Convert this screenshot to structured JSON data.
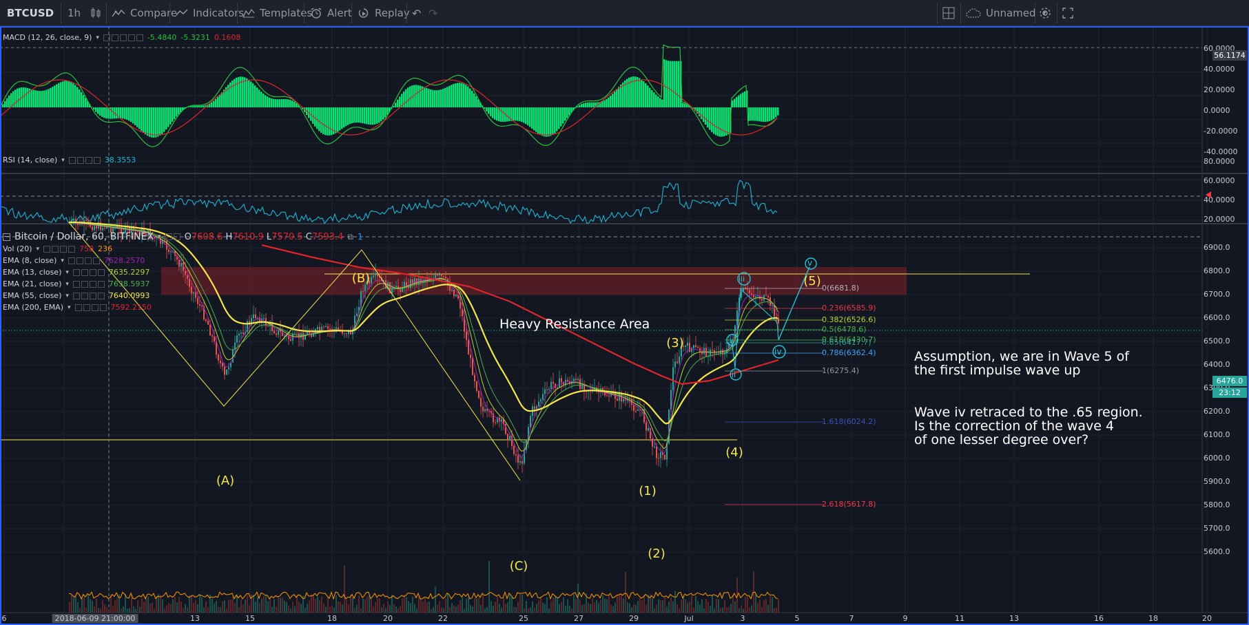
{
  "toolbar": {
    "symbol": "BTCUSD",
    "interval": "1h",
    "compare": "Compare",
    "indicators": "Indicators",
    "templates": "Templates",
    "alert": "Alert",
    "replay": "Replay",
    "layout_name": "Unnamed"
  },
  "macd": {
    "title": "MACD (12, 26, close, 9)",
    "v1": "-5.4840",
    "v2": "-5.3231",
    "v3": "0.1608",
    "ticks": [
      "60.0000",
      "40.0000",
      "20.0000",
      "0.0000",
      "-20.0000",
      "-40.0000"
    ],
    "last_tag": "56.1174"
  },
  "rsi": {
    "title": "RSI (14, close)",
    "value": "38.3553",
    "ticks": [
      "80.0000",
      "60.0000",
      "40.0000",
      "20.0000"
    ]
  },
  "main": {
    "title": "Bitcoin / Dollar, 60, BITFINEX",
    "o_label": "O",
    "o": "7608.6",
    "h_label": "H",
    "h": "7610.9",
    "l_label": "L",
    "l": "7570.5",
    "c_label": "C",
    "c": "7593.4",
    "alert_count": "1",
    "indicators": [
      {
        "name": "Vol (20)",
        "value": "758",
        "value2": "236"
      },
      {
        "name": "EMA (8, close)",
        "value": "7628.2570"
      },
      {
        "name": "EMA (13, close)",
        "value": "7635.2297"
      },
      {
        "name": "EMA (21, close)",
        "value": "7638.5937"
      },
      {
        "name": "EMA (55, close)",
        "value": "7640.0993"
      },
      {
        "name": "EMA (200, EMA)",
        "value": "7592.2150"
      }
    ],
    "price_ticks": [
      "6900.0",
      "6800.0",
      "6700.0",
      "6600.0",
      "6500.0",
      "6400.0",
      "6300.0",
      "6200.0",
      "6100.0",
      "6000.0",
      "5900.0",
      "5800.0",
      "5700.0",
      "5600.0"
    ],
    "last_price": "6476.0",
    "countdown": "23:12",
    "resistance_label": "Heavy Resistance Area",
    "waves": {
      "A": "(A)",
      "B": "(B)",
      "C": "(C)",
      "w1": "(1)",
      "w2": "(2)",
      "w3": "(3)",
      "w4": "(4)",
      "w5": "(5)",
      "i": "i",
      "ii": "ii",
      "iii": "iii",
      "iv": "iv",
      "v": "v"
    },
    "fib": [
      {
        "label": "0(6681.8)",
        "color": "#b2b5be"
      },
      {
        "label": "0.236(6585.9)",
        "color": "#f23645"
      },
      {
        "label": "0.382(6526.6)",
        "color": "#b5d334"
      },
      {
        "label": "0.5(6478.6)",
        "color": "#4caf50"
      },
      {
        "label": "0.618(6430.7)",
        "color": "#4caf50"
      },
      {
        "label": "0.65(6417.7)",
        "color": "#26a69a"
      },
      {
        "label": "0.786(6362.4)",
        "color": "#42a5f5"
      },
      {
        "label": "1(6275.4)",
        "color": "#9598a1"
      },
      {
        "label": "1.618(6024.2)",
        "color": "#3f51b5"
      },
      {
        "label": "2.618(5617.8)",
        "color": "#f23645"
      }
    ],
    "annotation1": [
      "Assumption, we are in Wave 5 of",
      "the first impulse wave up"
    ],
    "annotation2": [
      "Wave iv retraced to the .65 region.",
      "Is the correction of the wave 4",
      "of one lesser degree over?"
    ]
  },
  "xaxis": {
    "labels": [
      "6",
      "8",
      "2018-06-09 21:00:00",
      "13",
      "15",
      "18",
      "20",
      "22",
      "25",
      "27",
      "29",
      "Jul",
      "3",
      "5",
      "7",
      "9",
      "11",
      "13",
      "16",
      "18",
      "20"
    ]
  }
}
